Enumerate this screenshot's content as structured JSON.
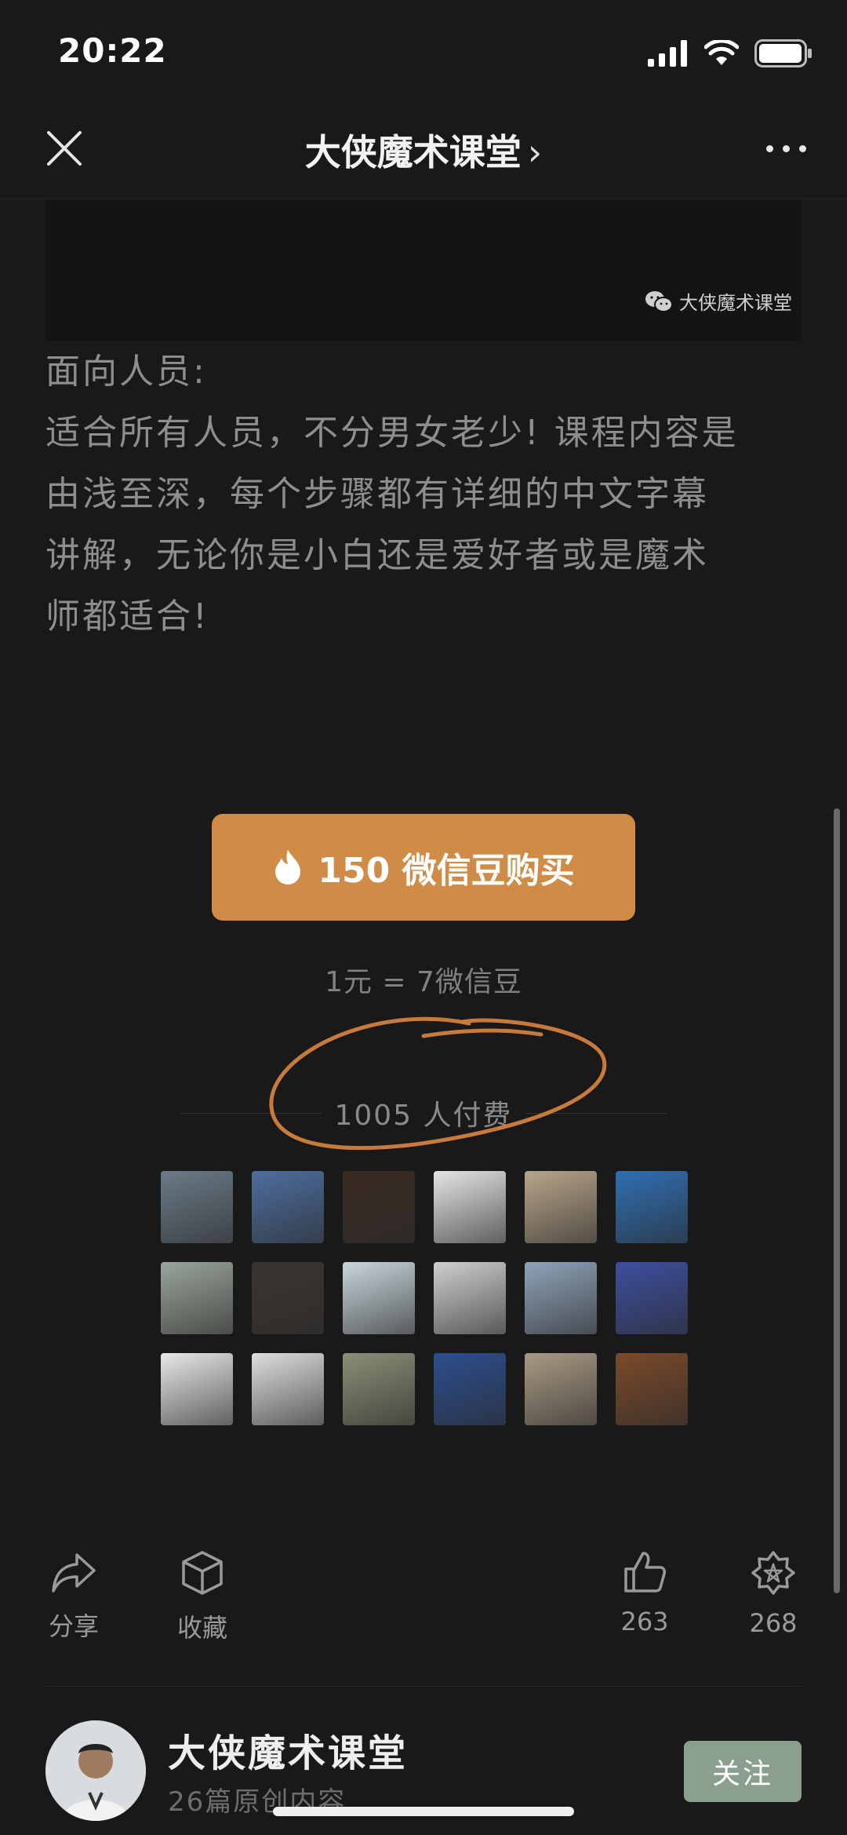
{
  "status_bar": {
    "time": "20:22"
  },
  "nav": {
    "title": "大侠魔术课堂",
    "chevron": "›"
  },
  "watermark": "大侠魔术课堂",
  "article": {
    "heading": "面向人员:",
    "lines": [
      "适合所有人员，不分男女老少! 课程内容是",
      "由浅至深，每个步骤都有详细的中文字幕",
      "讲解，无论你是小白还是爱好者或是魔术",
      "师都适合!"
    ]
  },
  "purchase": {
    "button_label": "150 微信豆购买",
    "rate": "1元 = 7微信豆",
    "payers": "1005 人付费",
    "avatar_colors": [
      "#6b7b88",
      "#4d6e9e",
      "#3a2a22",
      "#e5e5e5",
      "#b8a58a",
      "#2f6fb3",
      "#9aa59a",
      "#3b3530",
      "#c9d6dc",
      "#cfcfcf",
      "#8fa3b8",
      "#3d4f9e",
      "#e8e8e8",
      "#dedede",
      "#8b8f76",
      "#2c4e8f",
      "#a99a84",
      "#7a4a2a"
    ]
  },
  "actions": {
    "share_label": "分享",
    "collect_label": "收藏",
    "like_count": "263",
    "wow_count": "268"
  },
  "account": {
    "name": "大侠魔术课堂",
    "subtitle": "26篇原创内容",
    "follow_label": "关注"
  },
  "colors": {
    "background": "#191919",
    "buy_button": "#d08b46",
    "follow_button": "#8a9f8e",
    "annotation": "#c77a3a"
  }
}
